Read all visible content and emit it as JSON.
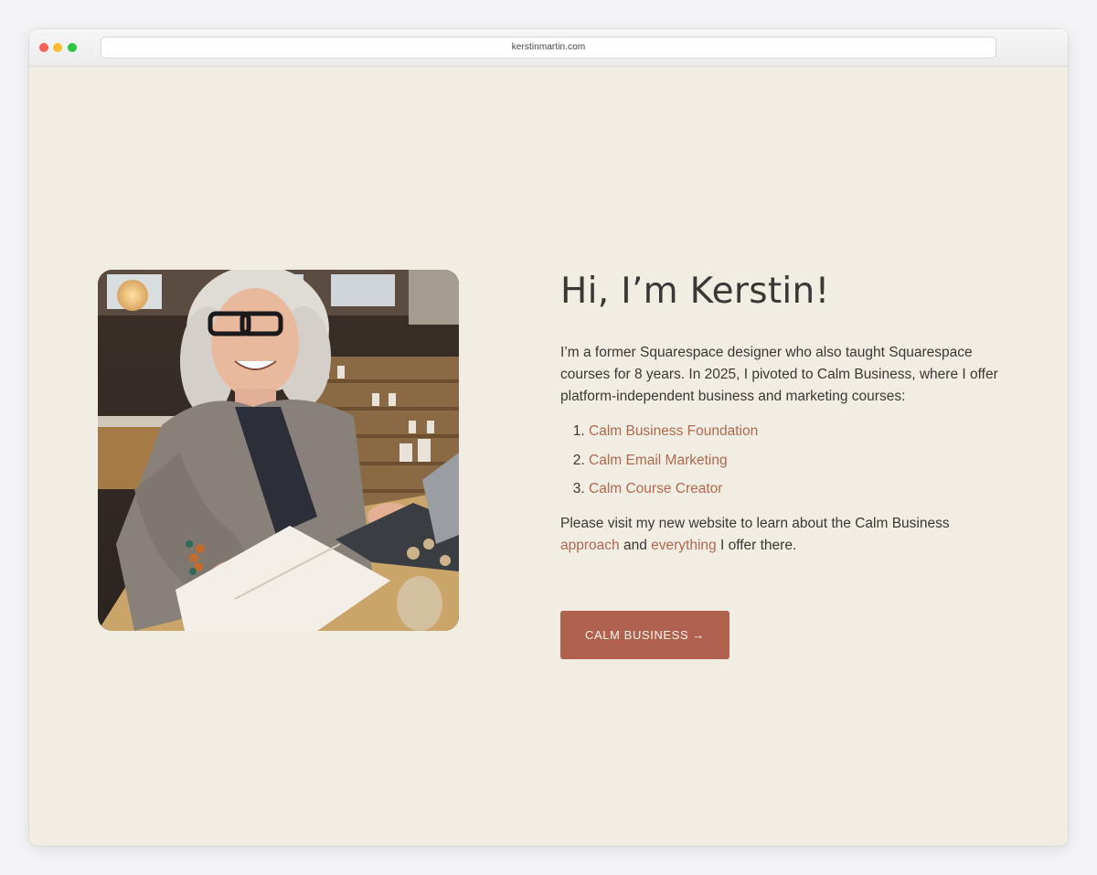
{
  "browser": {
    "url": "kerstinmartin.com"
  },
  "hero": {
    "heading": "Hi, I’m Kerstin!",
    "intro": "I’m a former Squarespace designer who also taught Squarespace courses for 8 years. In 2025, I pivoted to Calm Business, where I offer platform-independent business and marketing courses:",
    "courses": [
      {
        "number": "1.",
        "label": "Calm Business Foundation"
      },
      {
        "number": "2.",
        "label": "Calm Email Marketing"
      },
      {
        "number": "3.",
        "label": "Calm Course Creator"
      }
    ],
    "outro": {
      "prefix": "Please visit my new website to learn about the Calm Business",
      "link1": "approach",
      "middle": "and",
      "link2": "everything",
      "suffix": "I offer there."
    },
    "cta_label": "CALM BUSINESS →"
  },
  "colors": {
    "page_background": "#f2ede2",
    "accent": "#b0624e",
    "link": "#b0684f",
    "text": "#3a3734"
  }
}
